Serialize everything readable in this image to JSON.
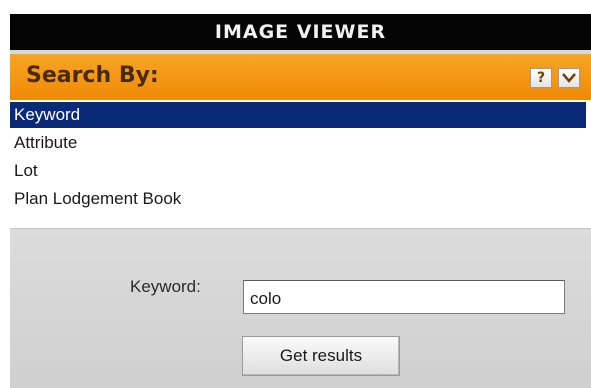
{
  "window": {
    "title": "IMAGE VIEWER"
  },
  "search_panel": {
    "label": "Search By:",
    "help_label": "?",
    "collapse_icon": "chevron-down-icon"
  },
  "search_options": {
    "items": [
      "Keyword",
      "Attribute",
      "Lot",
      "Plan Lodgement Book"
    ],
    "selected": "Keyword"
  },
  "form": {
    "keyword_label": "Keyword:",
    "keyword_value": "colo",
    "submit_label": "Get results"
  },
  "colors": {
    "title_bar": "#050505",
    "search_bar": "#f08a06",
    "selected_item": "#0a2a78"
  }
}
